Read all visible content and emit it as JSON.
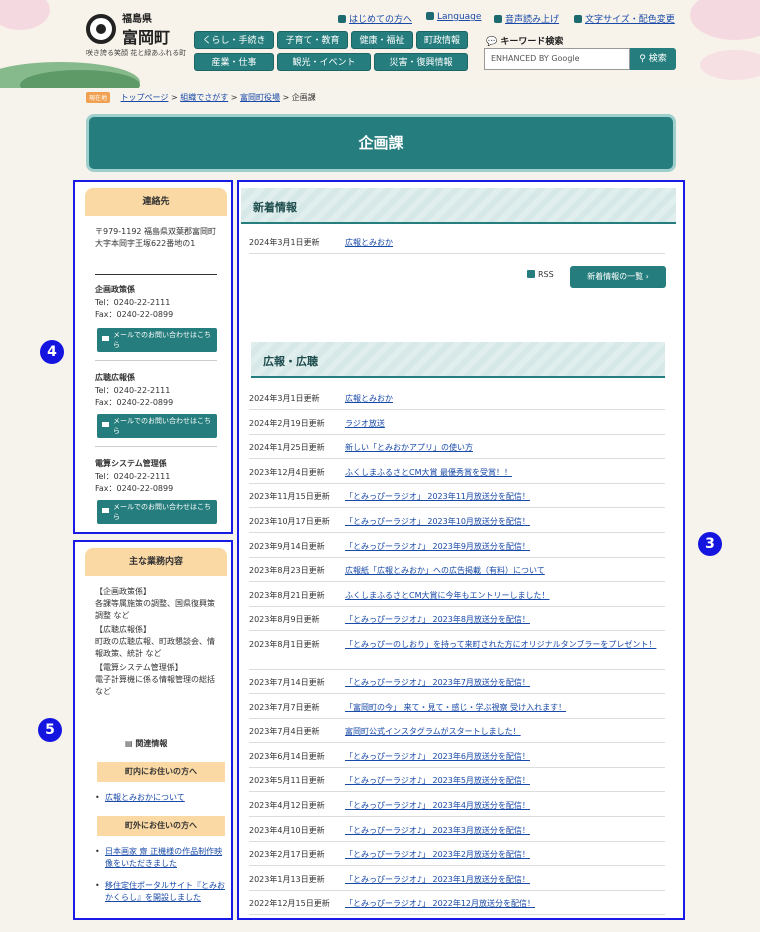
{
  "header": {
    "prefecture": "福島県",
    "town": "富岡町",
    "tagline": "咲き誇る笑顔 花と緑あふれる町",
    "util_links": [
      "はじめての方へ",
      "Language",
      "音声読み上げ",
      "文字サイズ・配色変更"
    ],
    "nav": [
      "くらし・手続き",
      "子育て・教育",
      "健康・福祉",
      "町政情報",
      "産業・仕事",
      "観光・イベント",
      "災害・復興情報"
    ],
    "keyword_label": "キーワード検索",
    "search_placeholder": "ENHANCED BY Google",
    "search_button": "検索"
  },
  "breadcrumb": {
    "tag": "現在地",
    "items": [
      "トップページ",
      "組織でさがす",
      "富岡町役場",
      "企画課"
    ]
  },
  "page_title": "企画課",
  "news": {
    "heading": "新着情報",
    "items": [
      {
        "date": "2024年3月1日更新",
        "title": "広報とみおか"
      }
    ],
    "rss": "RSS",
    "more": "新着情報の一覧"
  },
  "koho": {
    "heading": "広報・広聴",
    "items": [
      {
        "date": "2024年3月1日更新",
        "title": "広報とみおか"
      },
      {
        "date": "2024年2月19日更新",
        "title": "ラジオ放送"
      },
      {
        "date": "2024年1月25日更新",
        "title": "新しい「とみおかアプリ」の使い方"
      },
      {
        "date": "2023年12月4日更新",
        "title": "ふくしまふるさとCM大賞 最優秀賞を受賞！！"
      },
      {
        "date": "2023年11月15日更新",
        "title": "「とみっぴーラジオ」 2023年11月放送分を配信！"
      },
      {
        "date": "2023年10月17日更新",
        "title": "「とみっぴーラジオ」 2023年10月放送分を配信！"
      },
      {
        "date": "2023年9月14日更新",
        "title": "「とみっぴーラジオ♪」 2023年9月放送分を配信！"
      },
      {
        "date": "2023年8月23日更新",
        "title": "広報紙「広報とみおか」への広告掲載（有料）について"
      },
      {
        "date": "2023年8月21日更新",
        "title": "ふくしまふるさとCM大賞に今年もエントリーしました！"
      },
      {
        "date": "2023年8月9日更新",
        "title": "「とみっぴーラジオ♪」 2023年8月放送分を配信！"
      },
      {
        "date": "2023年8月1日更新",
        "title": "「とみっぴーのしおり」を持って来町された方にオリジナルタンブラーをプレゼント！"
      },
      {
        "date": "2023年7月14日更新",
        "title": "「とみっぴーラジオ♪」 2023年7月放送分を配信！"
      },
      {
        "date": "2023年7月7日更新",
        "title": "「富岡町の今」 来て・見て・感じ・学ぶ視察 受け入れます！"
      },
      {
        "date": "2023年7月4日更新",
        "title": "富岡町公式インスタグラムがスタートしました！"
      },
      {
        "date": "2023年6月14日更新",
        "title": "「とみっぴーラジオ♪」 2023年6月放送分を配信！"
      },
      {
        "date": "2023年5月11日更新",
        "title": "「とみっぴーラジオ♪」 2023年5月放送分を配信！"
      },
      {
        "date": "2023年4月12日更新",
        "title": "「とみっぴーラジオ♪」 2023年4月放送分を配信！"
      },
      {
        "date": "2023年4月10日更新",
        "title": "「とみっぴーラジオ♪」 2023年3月放送分を配信！"
      },
      {
        "date": "2023年2月17日更新",
        "title": "「とみっぴーラジオ♪」 2023年2月放送分を配信！"
      },
      {
        "date": "2023年1月13日更新",
        "title": "「とみっぴーラジオ♪」 2023年1月放送分を配信！"
      },
      {
        "date": "2022年12月15日更新",
        "title": "「とみっぴーラジオ♪」 2022年12月放送分を配信！"
      }
    ]
  },
  "contact": {
    "heading": "連絡先",
    "address": "〒979-1192 福島県双葉郡富岡町大字本岡字王塚622番地の1",
    "sections": [
      {
        "name": "企画政策係",
        "tel": "Tel：0240-22-2111",
        "fax": "Fax：0240-22-0899",
        "mail": "メールでのお問い合わせはこちら"
      },
      {
        "name": "広聴広報係",
        "tel": "Tel：0240-22-2111",
        "fax": "Fax：0240-22-0899",
        "mail": "メールでのお問い合わせはこちら"
      },
      {
        "name": "電算システム管理係",
        "tel": "Tel：0240-22-2111",
        "fax": "Fax：0240-22-0899",
        "mail": "メールでのお問い合わせはこちら"
      }
    ]
  },
  "duties": {
    "heading": "主な業務内容",
    "lines": [
      "【企画政策係】",
      "各課等属施策の調整、国県復興策調整 など",
      "【広聴広報係】",
      "町政の広聴広報、町政懇談会、情報政策、統計 など",
      "【電算システム管理係】",
      "電子計算機に係る情報管理の総括 など"
    ],
    "related_heading": "関連情報",
    "in_town": "町内にお住いの方へ",
    "in_town_links": [
      "広報とみおかについて"
    ],
    "out_town": "町外にお住いの方へ",
    "out_town_links": [
      "日本画家 齋 正機様の作品制作映像をいただきました",
      "移住定住ポータルサイト『とみおかくらし』を開設しました"
    ]
  },
  "badges": [
    "3",
    "4",
    "5"
  ]
}
